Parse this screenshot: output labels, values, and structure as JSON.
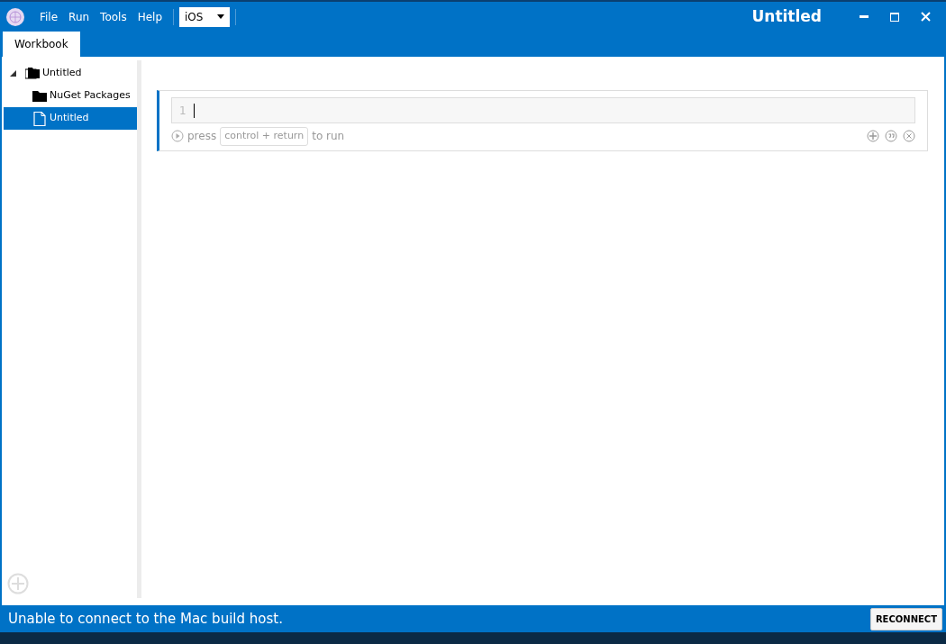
{
  "window": {
    "title": "Untitled"
  },
  "menu": [
    "File",
    "Run",
    "Tools",
    "Help"
  ],
  "platform_select": {
    "value": "iOS"
  },
  "tabs": [
    {
      "label": "Workbook",
      "selected": true
    }
  ],
  "tree": [
    {
      "label": "Untitled",
      "kind": "workbook",
      "expanded": true,
      "selected": false,
      "children": [
        {
          "label": "NuGet Packages",
          "kind": "folder",
          "selected": false
        },
        {
          "label": "Untitled",
          "kind": "file",
          "selected": true
        }
      ]
    }
  ],
  "cell": {
    "line_number": "1",
    "hint_before": "press",
    "shortcut": "control + return",
    "hint_after": "to run"
  },
  "status_bar": {
    "message": "Unable to connect to the Mac build host.",
    "button": "RECONNECT"
  }
}
